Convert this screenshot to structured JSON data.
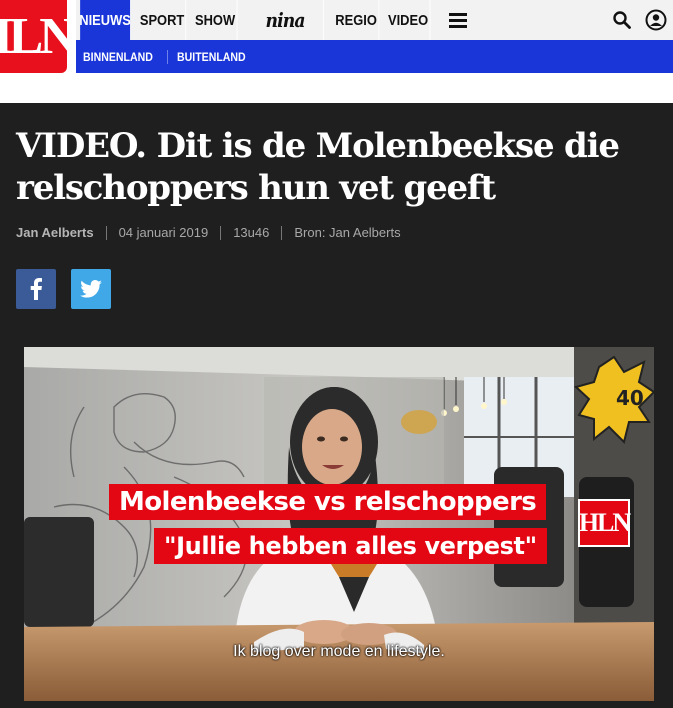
{
  "header": {
    "logo_text": "HLN",
    "tabs": [
      {
        "label": "NIEUWS",
        "active": true
      },
      {
        "label": "SPORT",
        "active": false
      },
      {
        "label": "SHOW",
        "active": false
      },
      {
        "label": "nina",
        "active": false
      },
      {
        "label": "REGIO",
        "active": false
      },
      {
        "label": "VIDEO",
        "active": false
      }
    ],
    "subnav": [
      "BINNENLAND",
      "BUITENLAND"
    ],
    "icons": [
      "menu-icon",
      "search-icon",
      "account-icon"
    ]
  },
  "article": {
    "title": "VIDEO. Dit is de Molenbeekse die relschoppers hun vet geeft",
    "author": "Jan Aelberts",
    "date": "04 januari 2019",
    "time": "13u46",
    "source": "Bron: Jan Aelberts",
    "share": [
      "facebook-icon",
      "twitter-icon"
    ]
  },
  "video": {
    "banner_line1": "Molenbeekse vs relschoppers",
    "banner_line2": "\"Jullie hebben alles verpest\"",
    "logo_text": "HLN",
    "subtitle": "Ik blog over mode en lifestyle.",
    "sign_text": "40"
  },
  "colors": {
    "brand_red": "#e8101c",
    "nav_blue": "#1a36d9",
    "article_bg": "#1f1f1f",
    "facebook": "#3b5b98",
    "twitter": "#41a8e8"
  }
}
